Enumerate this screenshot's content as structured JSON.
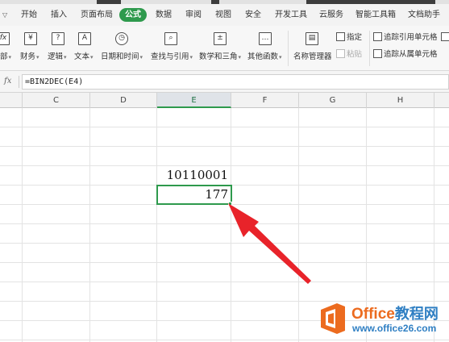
{
  "menu": {
    "tabs": [
      {
        "label": "开始"
      },
      {
        "label": "插入"
      },
      {
        "label": "页面布局"
      },
      {
        "label": "公式",
        "active": true
      },
      {
        "label": "数据"
      },
      {
        "label": "审阅"
      },
      {
        "label": "视图"
      },
      {
        "label": "安全"
      },
      {
        "label": "开发工具"
      },
      {
        "label": "云服务"
      },
      {
        "label": "智能工具箱"
      },
      {
        "label": "文档助手"
      }
    ]
  },
  "ribbon": {
    "buttons": [
      {
        "label": "部",
        "icon": "fx-icon"
      },
      {
        "label": "财务",
        "icon": "yen-icon"
      },
      {
        "label": "逻辑",
        "icon": "question-icon"
      },
      {
        "label": "文本",
        "icon": "text-a-icon"
      },
      {
        "label": "日期和时间",
        "icon": "clock-icon"
      },
      {
        "label": "查找与引用",
        "icon": "lookup-icon"
      },
      {
        "label": "数学和三角",
        "icon": "math-icon"
      },
      {
        "label": "其他函数",
        "icon": "more-functions-icon"
      }
    ],
    "name_manager": {
      "label": "名称管理器",
      "icon": "name-manager-icon"
    },
    "specify": {
      "label": "指定"
    },
    "paste": {
      "label": "粘贴"
    },
    "trace_precedents": {
      "label": "追踪引用单元格"
    },
    "trace_dependents": {
      "label": "追踪从属单元格"
    }
  },
  "formula_bar": {
    "fx_label": "fx",
    "formula": "=BIN2DEC(E4)"
  },
  "columns": [
    "C",
    "D",
    "E",
    "F",
    "G",
    "H"
  ],
  "selected_column": "E",
  "cells": {
    "E3": "10110001",
    "E4": "177"
  },
  "selected_cell": "E4",
  "watermark": {
    "brand_latin": "Office",
    "brand_cn": "教程网",
    "url": "www.office26.com"
  },
  "colors": {
    "accent_green": "#2e9a4d",
    "arrow_red": "#e8232a",
    "brand_orange": "#ec6b1f",
    "brand_blue": "#2f7fc3"
  }
}
